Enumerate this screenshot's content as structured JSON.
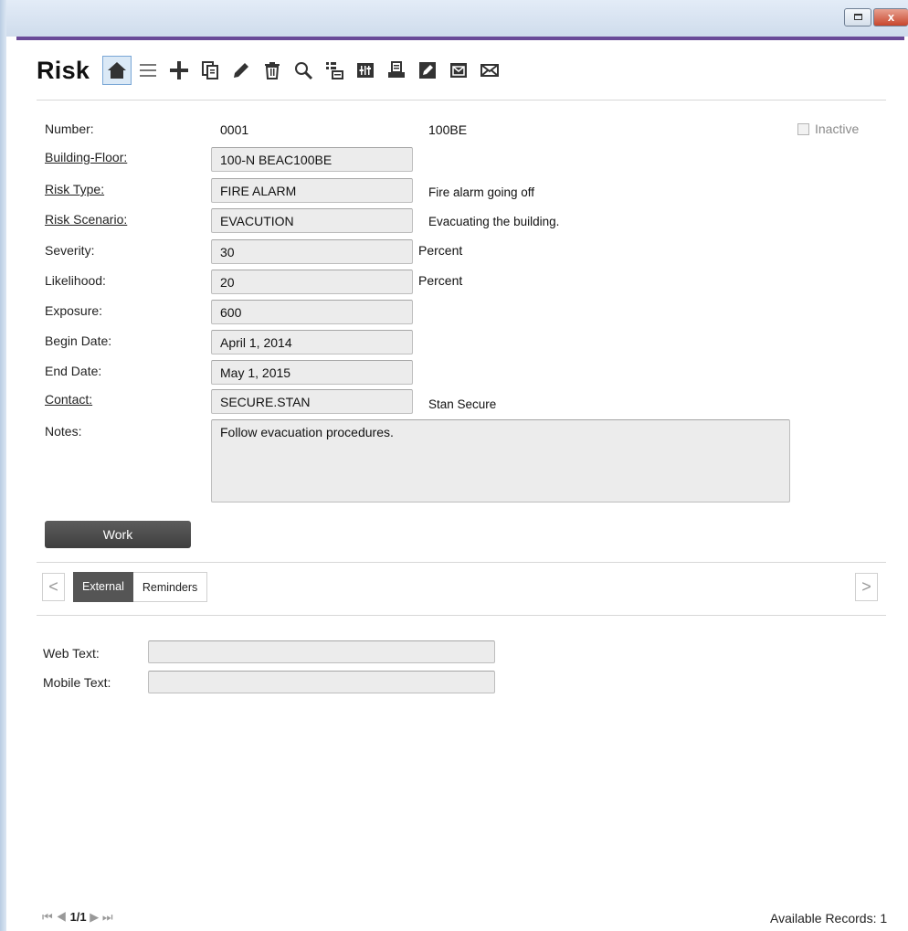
{
  "window": {
    "close_label": "x"
  },
  "header": {
    "title": "Risk"
  },
  "toolbar": {
    "icons": [
      "home-icon",
      "list-icon",
      "add-icon",
      "copy-icon",
      "edit-icon",
      "delete-icon",
      "search-icon",
      "tree-icon",
      "filter-icon",
      "print-icon",
      "note-icon",
      "email-icon",
      "envelope-icon"
    ]
  },
  "form": {
    "number_label": "Number:",
    "number_value": "0001",
    "number_extra": "100BE",
    "inactive_label": "Inactive",
    "building_floor_label": "Building-Floor:",
    "building_floor_value": "100-N BEAC100BE",
    "risk_type_label": "Risk Type:",
    "risk_type_value": "FIRE ALARM",
    "risk_type_desc": "Fire alarm going off",
    "risk_scenario_label": "Risk Scenario:",
    "risk_scenario_value": "EVACUTION",
    "risk_scenario_desc": "Evacuating the building.",
    "severity_label": "Severity:",
    "severity_value": "30",
    "severity_unit": "Percent",
    "likelihood_label": "Likelihood:",
    "likelihood_value": "20",
    "likelihood_unit": "Percent",
    "exposure_label": "Exposure:",
    "exposure_value": "600",
    "begin_date_label": "Begin Date:",
    "begin_date_value": "April 1, 2014",
    "end_date_label": "End Date:",
    "end_date_value": "May 1, 2015",
    "contact_label": "Contact:",
    "contact_value": "SECURE.STAN",
    "contact_name": "Stan Secure",
    "notes_label": "Notes:",
    "notes_value": "Follow evacuation procedures."
  },
  "actions": {
    "work_label": "Work"
  },
  "tabs": {
    "prev": "<",
    "next": ">",
    "items": [
      "External",
      "Reminders"
    ]
  },
  "external": {
    "web_text_label": "Web Text:",
    "web_text_value": "",
    "mobile_text_label": "Mobile Text:",
    "mobile_text_value": ""
  },
  "footer": {
    "first": "⏮",
    "prev": "◀",
    "record_position": "1/1",
    "next": "▶",
    "last": "⏭",
    "available_records": "Available Records:  1"
  }
}
